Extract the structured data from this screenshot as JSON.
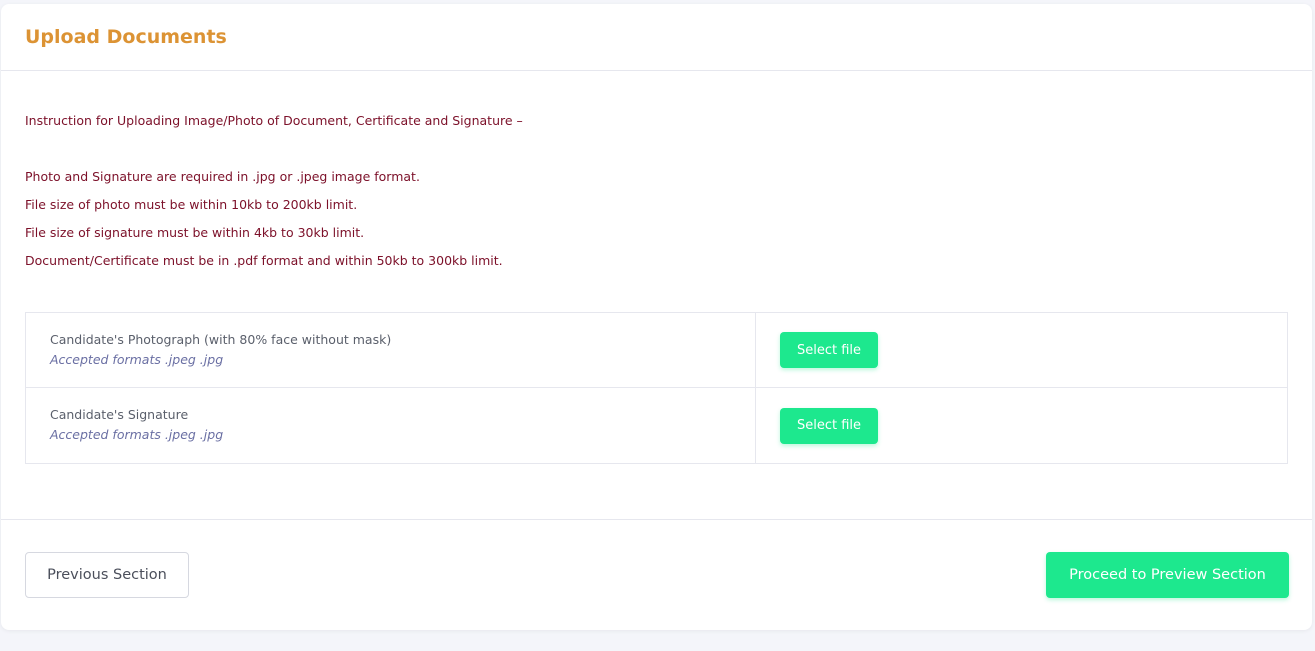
{
  "header": {
    "title": "Upload Documents"
  },
  "instructions": {
    "intro": "Instruction for Uploading Image/Photo of Document, Certificate and Signature –",
    "lines": [
      "Photo and Signature are required in .jpg or .jpeg image format.",
      "File size of photo must be within 10kb to 200kb limit.",
      "File size of signature must be within 4kb to 30kb limit.",
      "Document/Certificate must be in .pdf format and within 50kb to 300kb limit."
    ]
  },
  "uploads": [
    {
      "label": "Candidate's Photograph (with 80% face without mask)",
      "formats": "Accepted formats .jpeg .jpg",
      "button": "Select file"
    },
    {
      "label": "Candidate's Signature",
      "formats": "Accepted formats .jpeg .jpg",
      "button": "Select file"
    }
  ],
  "footer": {
    "previous_label": "Previous Section",
    "next_label": "Proceed to Preview Section"
  },
  "colors": {
    "title": "#dc9334",
    "instruction_text": "#7c1029",
    "accent_button": "#1de88e",
    "formats_text": "#6a6fa3",
    "page_background": "#f4f5fa"
  }
}
